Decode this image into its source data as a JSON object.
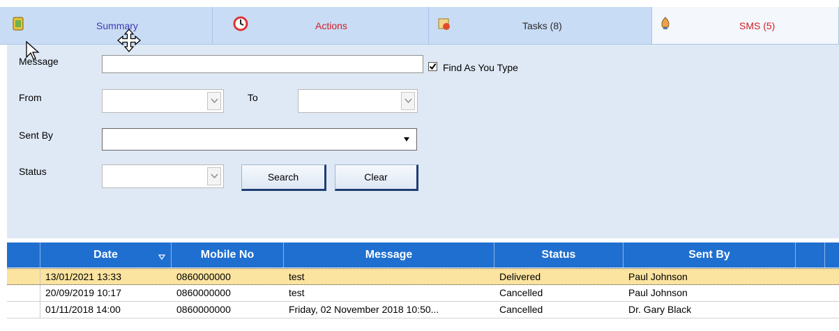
{
  "tabs": [
    {
      "label": "Summary",
      "icon": "summary-icon",
      "color": "#3b3bb0"
    },
    {
      "label": "Actions",
      "icon": "actions-clock-icon",
      "color": "#d0202a"
    },
    {
      "label": "Tasks (8)",
      "icon": "tasks-icon",
      "color": "#2a2a2a"
    },
    {
      "label": "SMS (5)",
      "icon": "sms-icon",
      "color": "#d0202a"
    }
  ],
  "form": {
    "message_label": "Message",
    "message_value": "",
    "find_as_you_type_label": "Find As You Type",
    "find_as_you_type_checked": true,
    "from_label": "From",
    "from_value": "",
    "to_label": "To",
    "to_value": "",
    "sent_by_label": "Sent By",
    "sent_by_value": "",
    "status_label": "Status",
    "status_value": "",
    "search_button": "Search",
    "clear_button": "Clear"
  },
  "grid": {
    "columns": [
      "Date",
      "Mobile No",
      "Message",
      "Status",
      "Sent By"
    ],
    "rows": [
      {
        "date": "13/01/2021 13:33",
        "mobile": "0860000000",
        "message": "test",
        "status": "Delivered",
        "sent_by": "Paul Johnson",
        "selected": true
      },
      {
        "date": "20/09/2019 10:17",
        "mobile": "0860000000",
        "message": "test",
        "status": "Cancelled",
        "sent_by": "Paul Johnson",
        "selected": false
      },
      {
        "date": "01/11/2018 14:00",
        "mobile": "0860000000",
        "message": "Friday, 02 November 2018 10:50...",
        "status": "Cancelled",
        "sent_by": "Dr. Gary Black",
        "selected": false
      }
    ]
  },
  "colors": {
    "tab_bg": "#c9dcf5",
    "panel_bg": "#dfe9f5",
    "grid_header": "#1f6fd0",
    "selected_row": "#fbe3a0"
  }
}
